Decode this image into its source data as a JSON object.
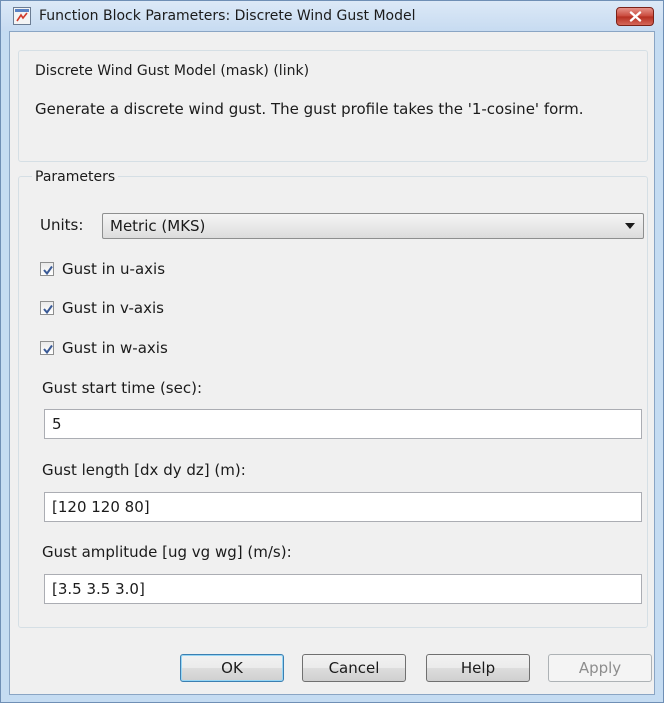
{
  "window": {
    "title": "Function Block Parameters: Discrete Wind Gust Model"
  },
  "description": {
    "group_title": "Discrete Wind Gust Model (mask) (link)",
    "text": "Generate a discrete wind gust. The gust profile takes the '1-cosine' form."
  },
  "parameters": {
    "group_title": "Parameters",
    "units_label": "Units:",
    "units_value": "Metric (MKS)",
    "checkboxes": [
      {
        "label": "Gust in u-axis",
        "checked": true
      },
      {
        "label": "Gust in v-axis",
        "checked": true
      },
      {
        "label": "Gust in w-axis",
        "checked": true
      }
    ],
    "fields": [
      {
        "label": "Gust start time (sec):",
        "value": "5"
      },
      {
        "label": "Gust length [dx dy dz] (m):",
        "value": "[120 120 80]"
      },
      {
        "label": "Gust amplitude [ug vg wg] (m/s):",
        "value": "[3.5 3.5 3.0]"
      }
    ]
  },
  "buttons": {
    "ok": "OK",
    "cancel": "Cancel",
    "help": "Help",
    "apply": "Apply"
  },
  "icons": {
    "title_icon": "simulink-block-icon",
    "close": "close-icon",
    "dropdown": "chevron-down-icon",
    "check": "checkmark-icon"
  },
  "colors": {
    "close_button": "#c8473a",
    "check_mark": "#3a5a96",
    "window_frame": "#c5dcf2"
  }
}
